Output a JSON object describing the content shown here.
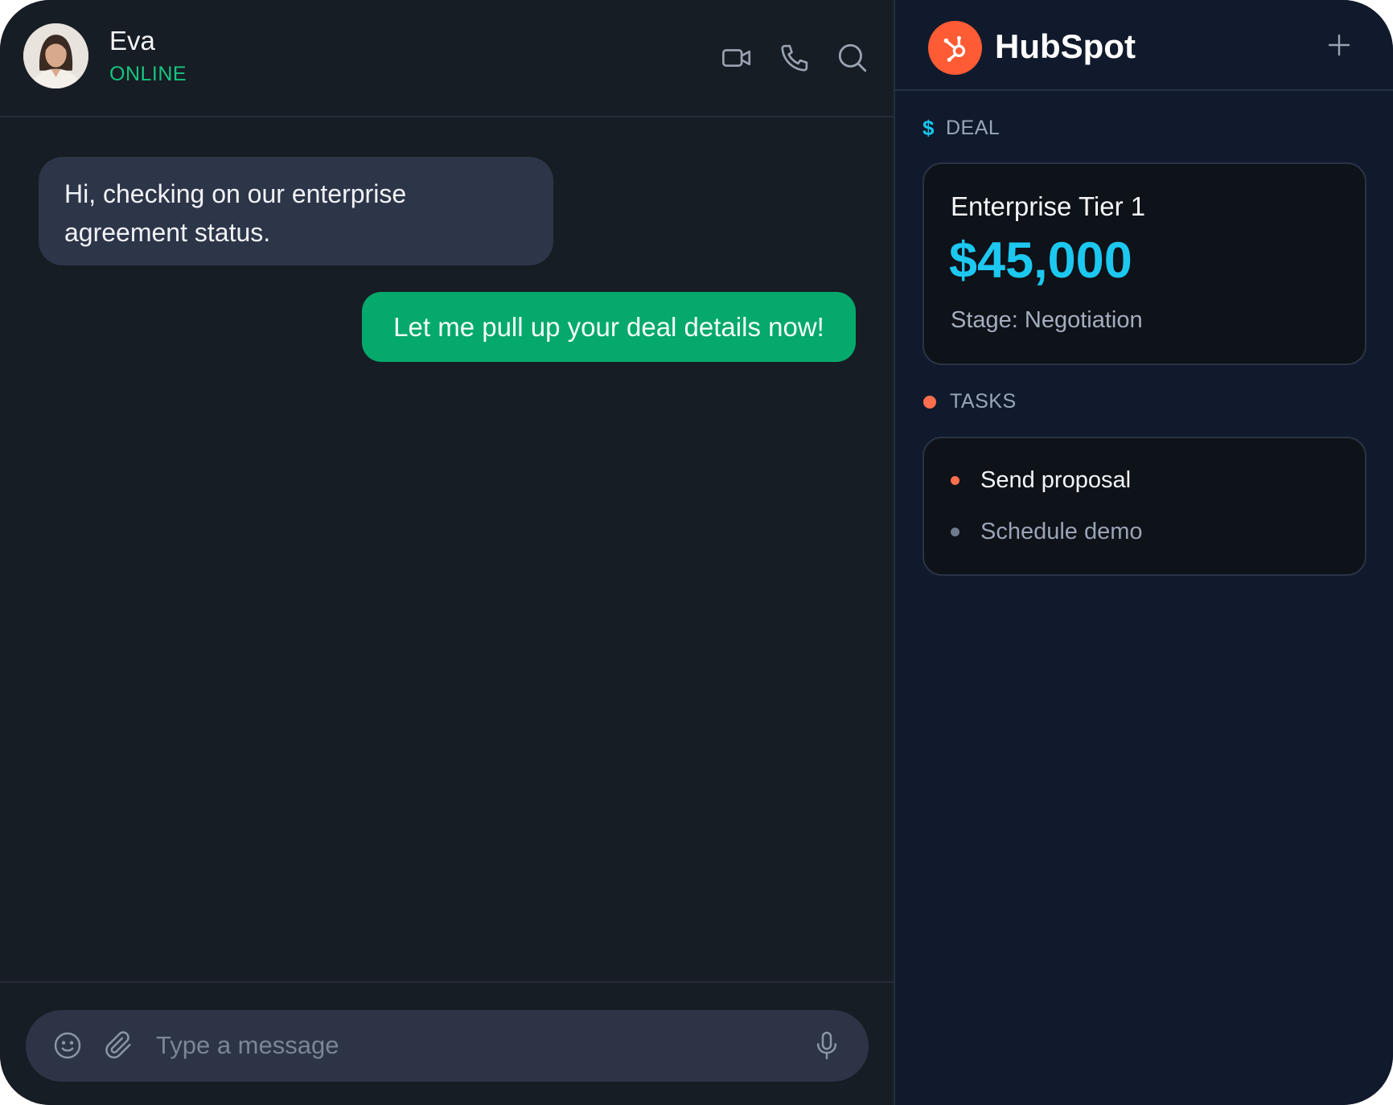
{
  "chat": {
    "contact": {
      "name": "Eva",
      "status": "ONLINE",
      "avatar_icon": "person-avatar"
    },
    "header_icons": [
      "video-camera-icon",
      "phone-icon",
      "search-icon"
    ],
    "messages": [
      {
        "direction": "incoming",
        "text": "Hi, checking on our enterprise agreement status."
      },
      {
        "direction": "outgoing",
        "text": "Let me pull up your deal details now!"
      }
    ],
    "composer": {
      "placeholder": "Type a message",
      "icons": [
        "emoji-icon",
        "paperclip-icon",
        "microphone-icon"
      ]
    }
  },
  "crm": {
    "brand": "HubSpot",
    "logo_icon": "hubspot-sprocket-icon",
    "add_icon": "plus-icon",
    "deal_section": {
      "label": "DEAL",
      "icon": "$",
      "name": "Enterprise Tier 1",
      "amount": "$45,000",
      "stage": "Stage: Negotiation"
    },
    "tasks_section": {
      "label": "TASKS",
      "items": [
        {
          "label": "Send proposal",
          "bullet_color": "#ff6f4e",
          "text_color": "#f3f5f8"
        },
        {
          "label": "Schedule demo",
          "bullet_color": "#6f7a8d",
          "text_color": "#9aa4b6"
        }
      ]
    }
  },
  "colors": {
    "chat_bg": "#171d24",
    "crm_bg": "#111a2c",
    "incoming_bubble": "#2d3549",
    "outgoing_bubble": "#05a96b",
    "online_green": "#16c47f",
    "accent_cyan": "#1cc8f0",
    "hubspot_orange": "#ff5b35"
  }
}
